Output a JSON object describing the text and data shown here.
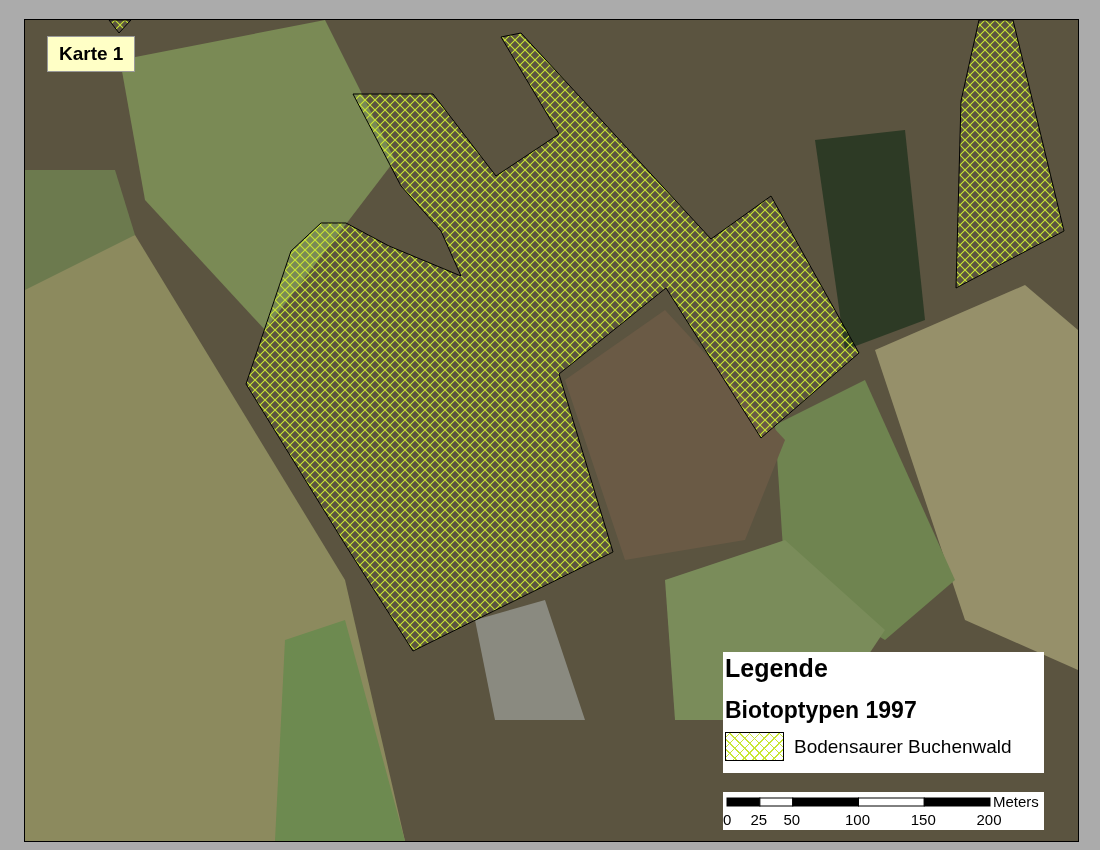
{
  "map_label": "Karte 1",
  "legend": {
    "title": "Legende",
    "subtitle": "Biotoptypen 1997",
    "items": [
      {
        "label": "Bodensaurer Buchenwald",
        "color": "#c8e632"
      }
    ]
  },
  "scale_bar": {
    "unit": "Meters",
    "ticks": [
      "0",
      "25",
      "50",
      "100",
      "150",
      "200"
    ]
  }
}
